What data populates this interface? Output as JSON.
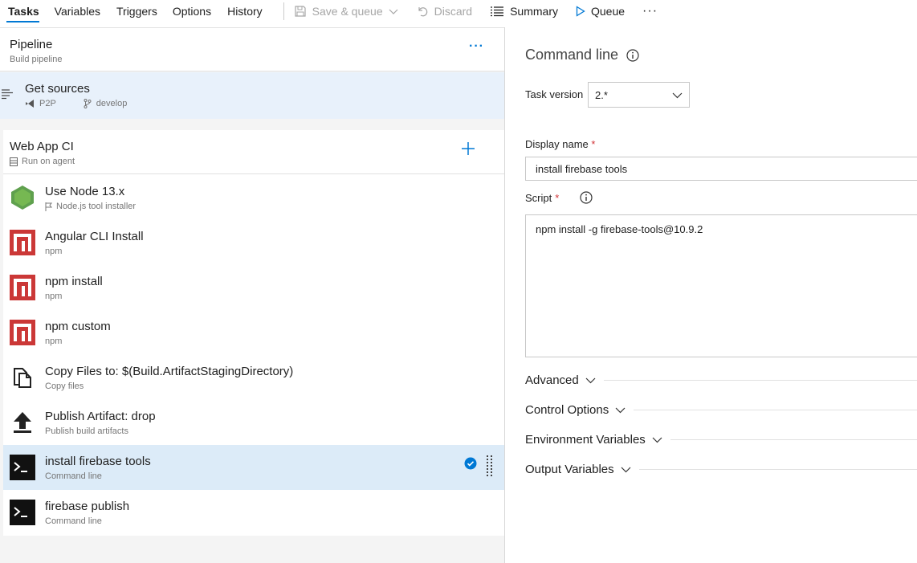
{
  "toolbar": {
    "tabs": [
      {
        "label": "Tasks",
        "active": true
      },
      {
        "label": "Variables"
      },
      {
        "label": "Triggers"
      },
      {
        "label": "Options"
      },
      {
        "label": "History"
      }
    ],
    "save_queue_label": "Save & queue",
    "discard_label": "Discard",
    "summary_label": "Summary",
    "queue_label": "Queue",
    "more_label": "···"
  },
  "pipeline": {
    "title": "Pipeline",
    "subtitle": "Build pipeline",
    "more_label": "···"
  },
  "get_sources": {
    "title": "Get sources",
    "repo": "P2P",
    "branch": "develop"
  },
  "job": {
    "title": "Web App CI",
    "subtitle": "Run on agent"
  },
  "tasks": [
    {
      "name": "Use Node 13.x",
      "sub": "Node.js tool installer",
      "icon": "nodejs-icon"
    },
    {
      "name": "Angular CLI Install",
      "sub": "npm",
      "icon": "npm-icon"
    },
    {
      "name": "npm install",
      "sub": "npm",
      "icon": "npm-icon"
    },
    {
      "name": "npm custom",
      "sub": "npm",
      "icon": "npm-icon"
    },
    {
      "name": "Copy Files to: $(Build.ArtifactStagingDirectory)",
      "sub": "Copy files",
      "icon": "copy-files-icon"
    },
    {
      "name": "Publish Artifact: drop",
      "sub": "Publish build artifacts",
      "icon": "upload-icon"
    },
    {
      "name": "install firebase tools",
      "sub": "Command line",
      "icon": "terminal-icon",
      "selected": true
    },
    {
      "name": "firebase publish",
      "sub": "Command line",
      "icon": "terminal-icon"
    }
  ],
  "details": {
    "title": "Command line",
    "task_version_label": "Task version",
    "task_version_value": "2.*",
    "display_name_label": "Display name",
    "display_name_value": "install firebase tools",
    "script_label": "Script",
    "script_value": "npm install -g firebase-tools@10.9.2",
    "required_mark": "*",
    "sections": [
      "Advanced",
      "Control Options",
      "Environment Variables",
      "Output Variables"
    ]
  },
  "colors": {
    "accent": "#0078d4",
    "npm_red": "#cb3837",
    "node_green": "#5fa04e",
    "selected_bg": "#dcebf8"
  }
}
